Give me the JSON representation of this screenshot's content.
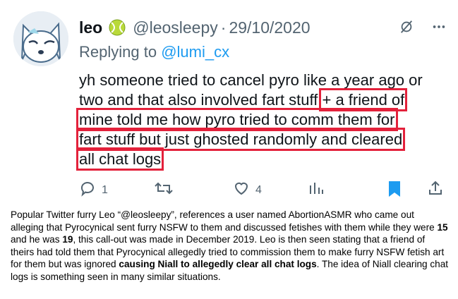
{
  "tweet": {
    "name": "leo",
    "handle": "@leosleepy",
    "separator": "·",
    "date": "29/10/2020",
    "replying_to_prefix": "Replying to ",
    "replying_to_handle": "@lumi_cx",
    "text_line1": "yh someone tried to cancel pyro like a year ago or",
    "text_line2a": "two and that also involved fart stuff",
    "text_line2b": "+ a friend of",
    "text_line3": "mine told me how pyro tried to comm them for",
    "text_line4": "fart stuff but just ghosted randomly and cleared",
    "text_line5": "all chat logs",
    "highlight_color": "#e3213b",
    "actions": {
      "reply_count": "1",
      "retweet_count": "",
      "like_count": "4"
    },
    "icons": {
      "badge": "tennis-ball-icon",
      "header_left": "no-notification-icon",
      "header_right": "more-icon",
      "reply": "reply-icon",
      "retweet": "retweet-icon",
      "like": "heart-icon",
      "analytics": "analytics-icon",
      "bookmark": "bookmark-icon",
      "share": "share-icon"
    }
  },
  "caption": {
    "p1": "Popular Twitter furry Leo “@leosleepy”, references a user named AbortionASMR who came out alleging that Pyrocynical sent furry NSFW to them and discussed fetishes with them while they were ",
    "age1": "15",
    "p2": " and he was ",
    "age2": "19",
    "p3": ", this call-out was made in December 2019. Leo is then seen stating that a friend of theirs had told them that Pyrocynical allegedly tried to commission them to make furry NSFW fetish art for them but was ignored ",
    "bold_clause": "causing Niall to allegedly clear all chat logs",
    "p4": ". The idea of Niall clearing chat logs is something seen in many similar situations."
  }
}
